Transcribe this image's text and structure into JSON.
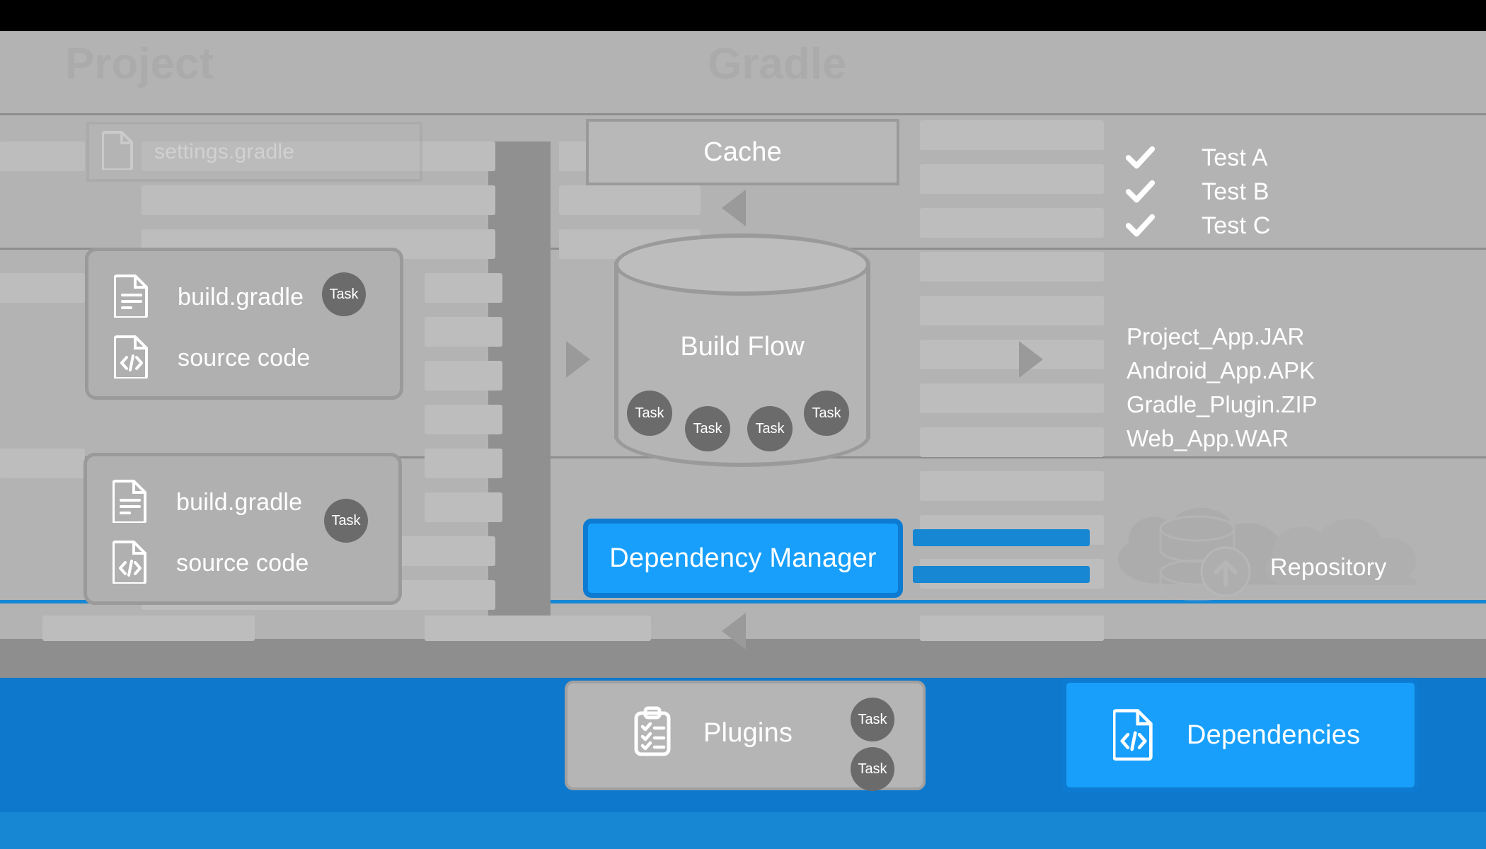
{
  "diagram": {
    "title": "Gradle Build Flow",
    "colors": {
      "accent_blue": "#189ffb",
      "accent_blue_dark": "#0d7bd1",
      "bar_blue": "#0d78cc",
      "band_light": "#b3b3b3",
      "band_mid": "#a8a8a8",
      "band_dark": "#8e8e8e",
      "card_gray": "#b0b0b0",
      "card_border": "#9a9a9a",
      "task_pill": "#6b6b6b",
      "text_white": "#ffffff"
    }
  },
  "ghost_headings": {
    "left": "Project",
    "right": "Gradle"
  },
  "settings_card": {
    "label": "settings.gradle",
    "icon": "document-icon"
  },
  "module_cards": [
    {
      "id": "module-1",
      "rows": [
        {
          "icon": "document-lines-icon",
          "label": "build.gradle"
        },
        {
          "icon": "code-file-icon",
          "label": "source code"
        }
      ],
      "task_badge": "Task"
    },
    {
      "id": "module-2",
      "rows": [
        {
          "icon": "document-lines-icon",
          "label": "build.gradle"
        },
        {
          "icon": "code-file-icon",
          "label": "source code"
        }
      ],
      "task_badge": "Task"
    }
  ],
  "cache": {
    "label": "Cache"
  },
  "build_flow": {
    "label": "Build Flow",
    "tasks": [
      "Task",
      "Task",
      "Task",
      "Task"
    ]
  },
  "tests": {
    "items": [
      {
        "label": "Test A",
        "icon": "check-icon",
        "status": "passed"
      },
      {
        "label": "Test B",
        "icon": "check-icon",
        "status": "passed"
      },
      {
        "label": "Test C",
        "icon": "check-icon",
        "status": "passed"
      }
    ]
  },
  "artifacts": {
    "items": [
      "Project_App.JAR",
      "Android_App.APK",
      "Gradle_Plugin.ZIP",
      "Web_App.WAR"
    ]
  },
  "dependency_manager": {
    "label": "Dependency Manager"
  },
  "repository": {
    "label": "Repository",
    "icon": "cloud-database-icon"
  },
  "plugins_card": {
    "label": "Plugins",
    "icon": "clipboard-checklist-icon",
    "tasks": [
      "Task",
      "Task"
    ]
  },
  "dependencies_card": {
    "label": "Dependencies",
    "icon": "code-file-icon"
  }
}
